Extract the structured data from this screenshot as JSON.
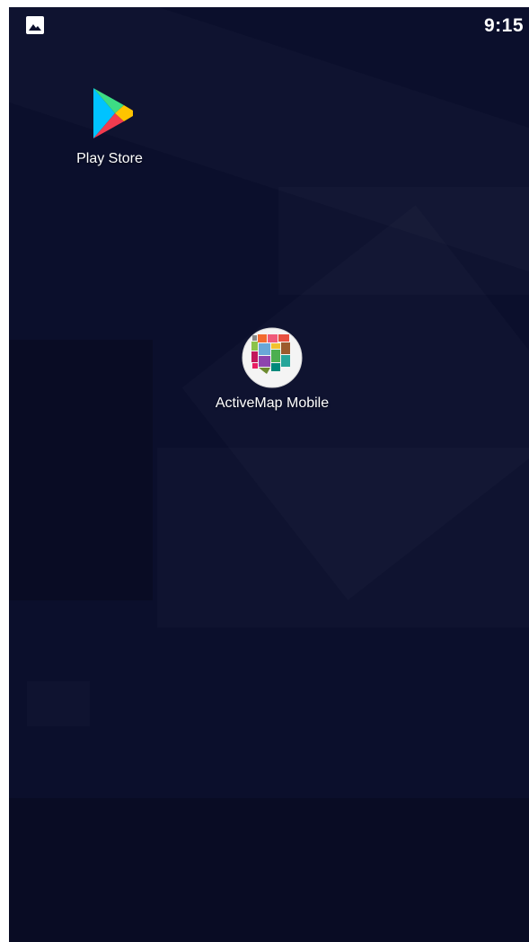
{
  "status_bar": {
    "time": "9:15",
    "notification_icon": "image-icon"
  },
  "apps": [
    {
      "label": "Play Store",
      "icon": "play-store-icon"
    },
    {
      "label": "ActiveMap Mobile",
      "icon": "activemap-icon"
    }
  ],
  "colors": {
    "background": "#0b0f2c",
    "text": "#ffffff"
  }
}
